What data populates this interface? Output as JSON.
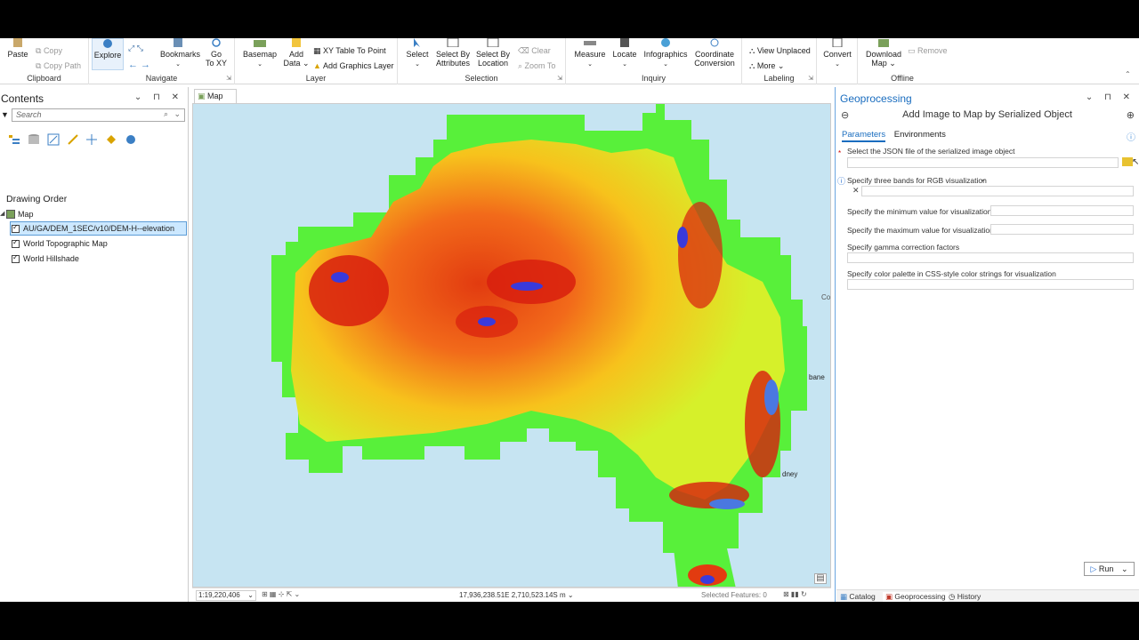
{
  "ribbon": {
    "clipboard": {
      "label": "Clipboard",
      "paste": "Paste",
      "copy": "Copy",
      "copy_path": "Copy Path"
    },
    "navigate": {
      "label": "Navigate",
      "explore": "Explore",
      "bookmarks": "Bookmarks",
      "go_to_xy_1": "Go",
      "go_to_xy_2": "To XY"
    },
    "layer": {
      "label": "Layer",
      "basemap": "Basemap",
      "add_data_1": "Add",
      "add_data_2": "Data",
      "xy_table": "XY Table To Point",
      "add_graphics": "Add Graphics Layer"
    },
    "selection": {
      "label": "Selection",
      "select": "Select",
      "select_by_attr_1": "Select By",
      "select_by_attr_2": "Attributes",
      "select_by_loc_1": "Select By",
      "select_by_loc_2": "Location",
      "clear": "Clear",
      "zoom_to": "Zoom To"
    },
    "inquiry": {
      "label": "Inquiry",
      "measure": "Measure",
      "locate": "Locate",
      "infographics": "Infographics",
      "coord_1": "Coordinate",
      "coord_2": "Conversion"
    },
    "labeling": {
      "label": "Labeling",
      "view_unplaced": "View Unplaced",
      "more": "More"
    },
    "convert": {
      "label": "Convert"
    },
    "offline": {
      "label": "Offline",
      "download_1": "Download",
      "download_2": "Map",
      "remove": "Remove"
    }
  },
  "contents": {
    "title": "Contents",
    "search_placeholder": "Search",
    "drawing_order": "Drawing Order",
    "map_node": "Map",
    "layers": [
      "AU/GA/DEM_1SEC/v10/DEM-H--elevation",
      "World Topographic Map",
      "World Hillshade"
    ]
  },
  "map": {
    "tab_label": "Map",
    "scale": "1:19,220,406",
    "coordinates": "17,936,238.51E 2,710,523.14S m",
    "selected_features": "Selected Features: 0",
    "labels": {
      "co": "Co",
      "brisbane": "bane",
      "sydney": "dney"
    }
  },
  "geoprocessing": {
    "title": "Geoprocessing",
    "tool_title": "Add Image to Map by Serialized Object",
    "tab_parameters": "Parameters",
    "tab_environments": "Environments",
    "params": {
      "json_file": "Select the JSON file of the serialized image object",
      "bands": "Specify three bands for RGB visualization",
      "min": "Specify the minimum value for visualization",
      "max": "Specify the maximum value for visualization",
      "gamma": "Specify gamma correction factors",
      "palette": "Specify color palette in CSS-style color strings for visualization"
    },
    "run": "Run",
    "bottom_tabs": [
      "Catalog",
      "Geoprocessing",
      "History"
    ]
  },
  "colors": {
    "accent": "#1a6dbf",
    "selection": "#cce8ff",
    "ocean": "#c6e4f2"
  }
}
